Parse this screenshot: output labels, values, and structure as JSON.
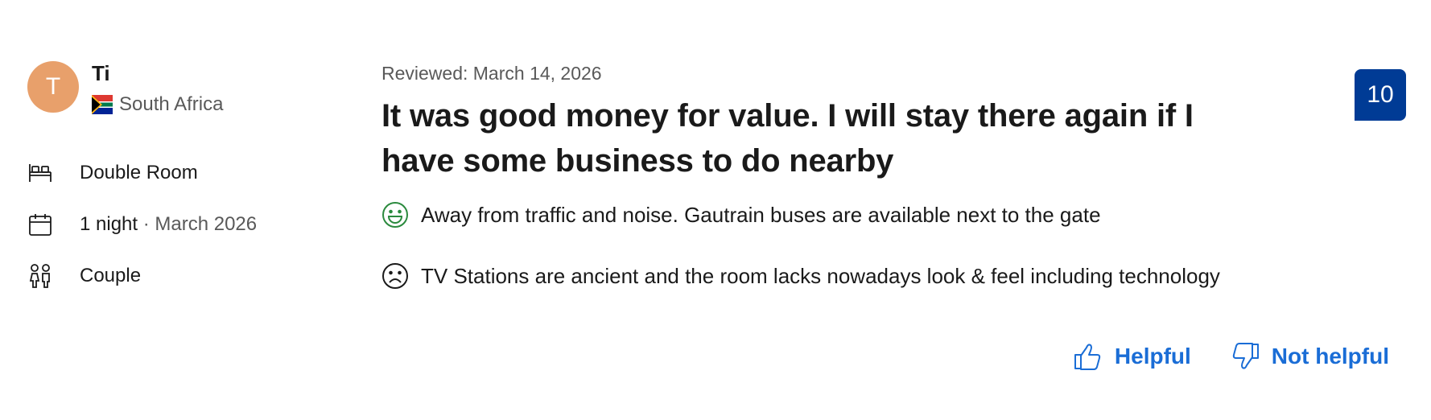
{
  "reviewer": {
    "initial": "T",
    "name": "Ti",
    "country": "South Africa",
    "flag_icon": "south-africa-flag-icon",
    "avatar_color": "#e8a06b"
  },
  "stay": {
    "room": "Double Room",
    "nights": "1 night",
    "separator": " · ",
    "date": "March 2026",
    "traveler_type": "Couple"
  },
  "review": {
    "reviewed_label": "Reviewed: March 14, 2026",
    "title": "It was good money for value. I will stay there again if I have some business to do nearby",
    "positive": "Away from traffic and noise. Gautrain buses are available next to the gate",
    "negative": "TV Stations are ancient and the room lacks nowadays look & feel including technology",
    "score": "10"
  },
  "feedback": {
    "helpful_label": "Helpful",
    "not_helpful_label": "Not helpful"
  },
  "colors": {
    "score_bg": "#003b95",
    "link": "#1a6dd6",
    "positive_icon": "#2b8a3e",
    "muted_text": "#595959"
  },
  "icons": {
    "room": "bed-icon",
    "date": "calendar-icon",
    "traveler": "people-icon",
    "positive": "smiley-happy-icon",
    "negative": "smiley-sad-icon",
    "helpful": "thumbs-up-icon",
    "not_helpful": "thumbs-down-icon"
  }
}
